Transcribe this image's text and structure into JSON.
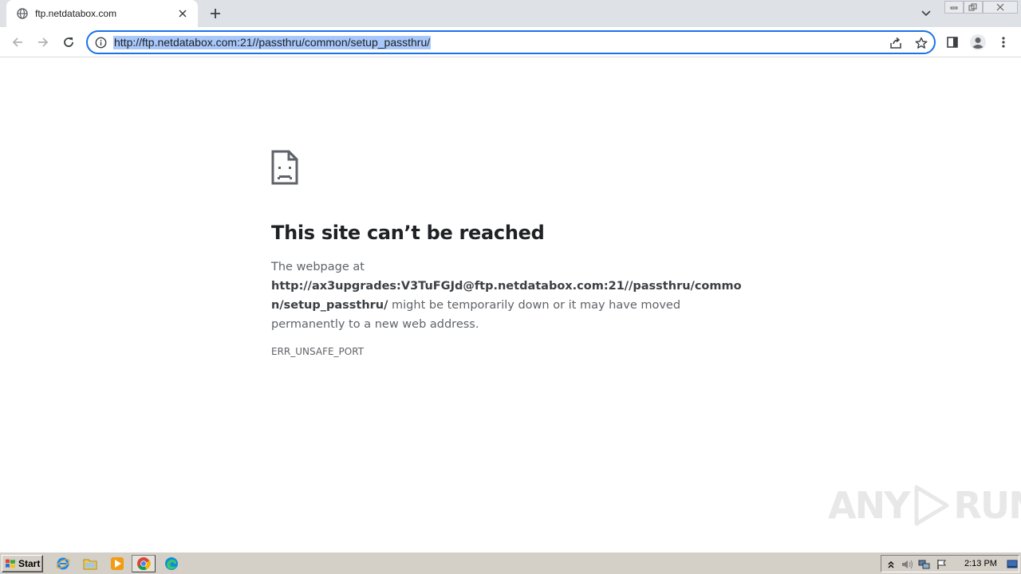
{
  "browser": {
    "tab_title": "ftp.netdatabox.com",
    "url": "http://ftp.netdatabox.com:21//passthru/common/setup_passthru/"
  },
  "error": {
    "title": "This site can’t be reached",
    "body_prefix": "The webpage at",
    "body_url": "http://ax3upgrades:V3TuFGJd@ftp.netdatabox.com:21//passthru/common/setup_passthru/",
    "body_suffix": " might be temporarily down or it may have moved permanently to a new web address.",
    "code": "ERR_UNSAFE_PORT"
  },
  "watermark": {
    "left": "ANY",
    "right": "RUN"
  },
  "taskbar": {
    "start_label": "Start",
    "time": "2:13 PM"
  },
  "icons": [
    "globe-icon",
    "close-icon",
    "plus-icon",
    "chevron-down-icon",
    "minimize-icon",
    "restore-icon",
    "back-icon",
    "forward-icon",
    "reload-icon",
    "info-icon",
    "share-icon",
    "star-icon",
    "side-panel-icon",
    "profile-icon",
    "kebab-menu-icon",
    "sad-page-icon",
    "ie-icon",
    "folder-icon",
    "media-player-icon",
    "chrome-icon",
    "edge-icon",
    "tray-expand-icon",
    "volume-icon",
    "network-icon",
    "flag-icon",
    "show-desktop-icon"
  ]
}
